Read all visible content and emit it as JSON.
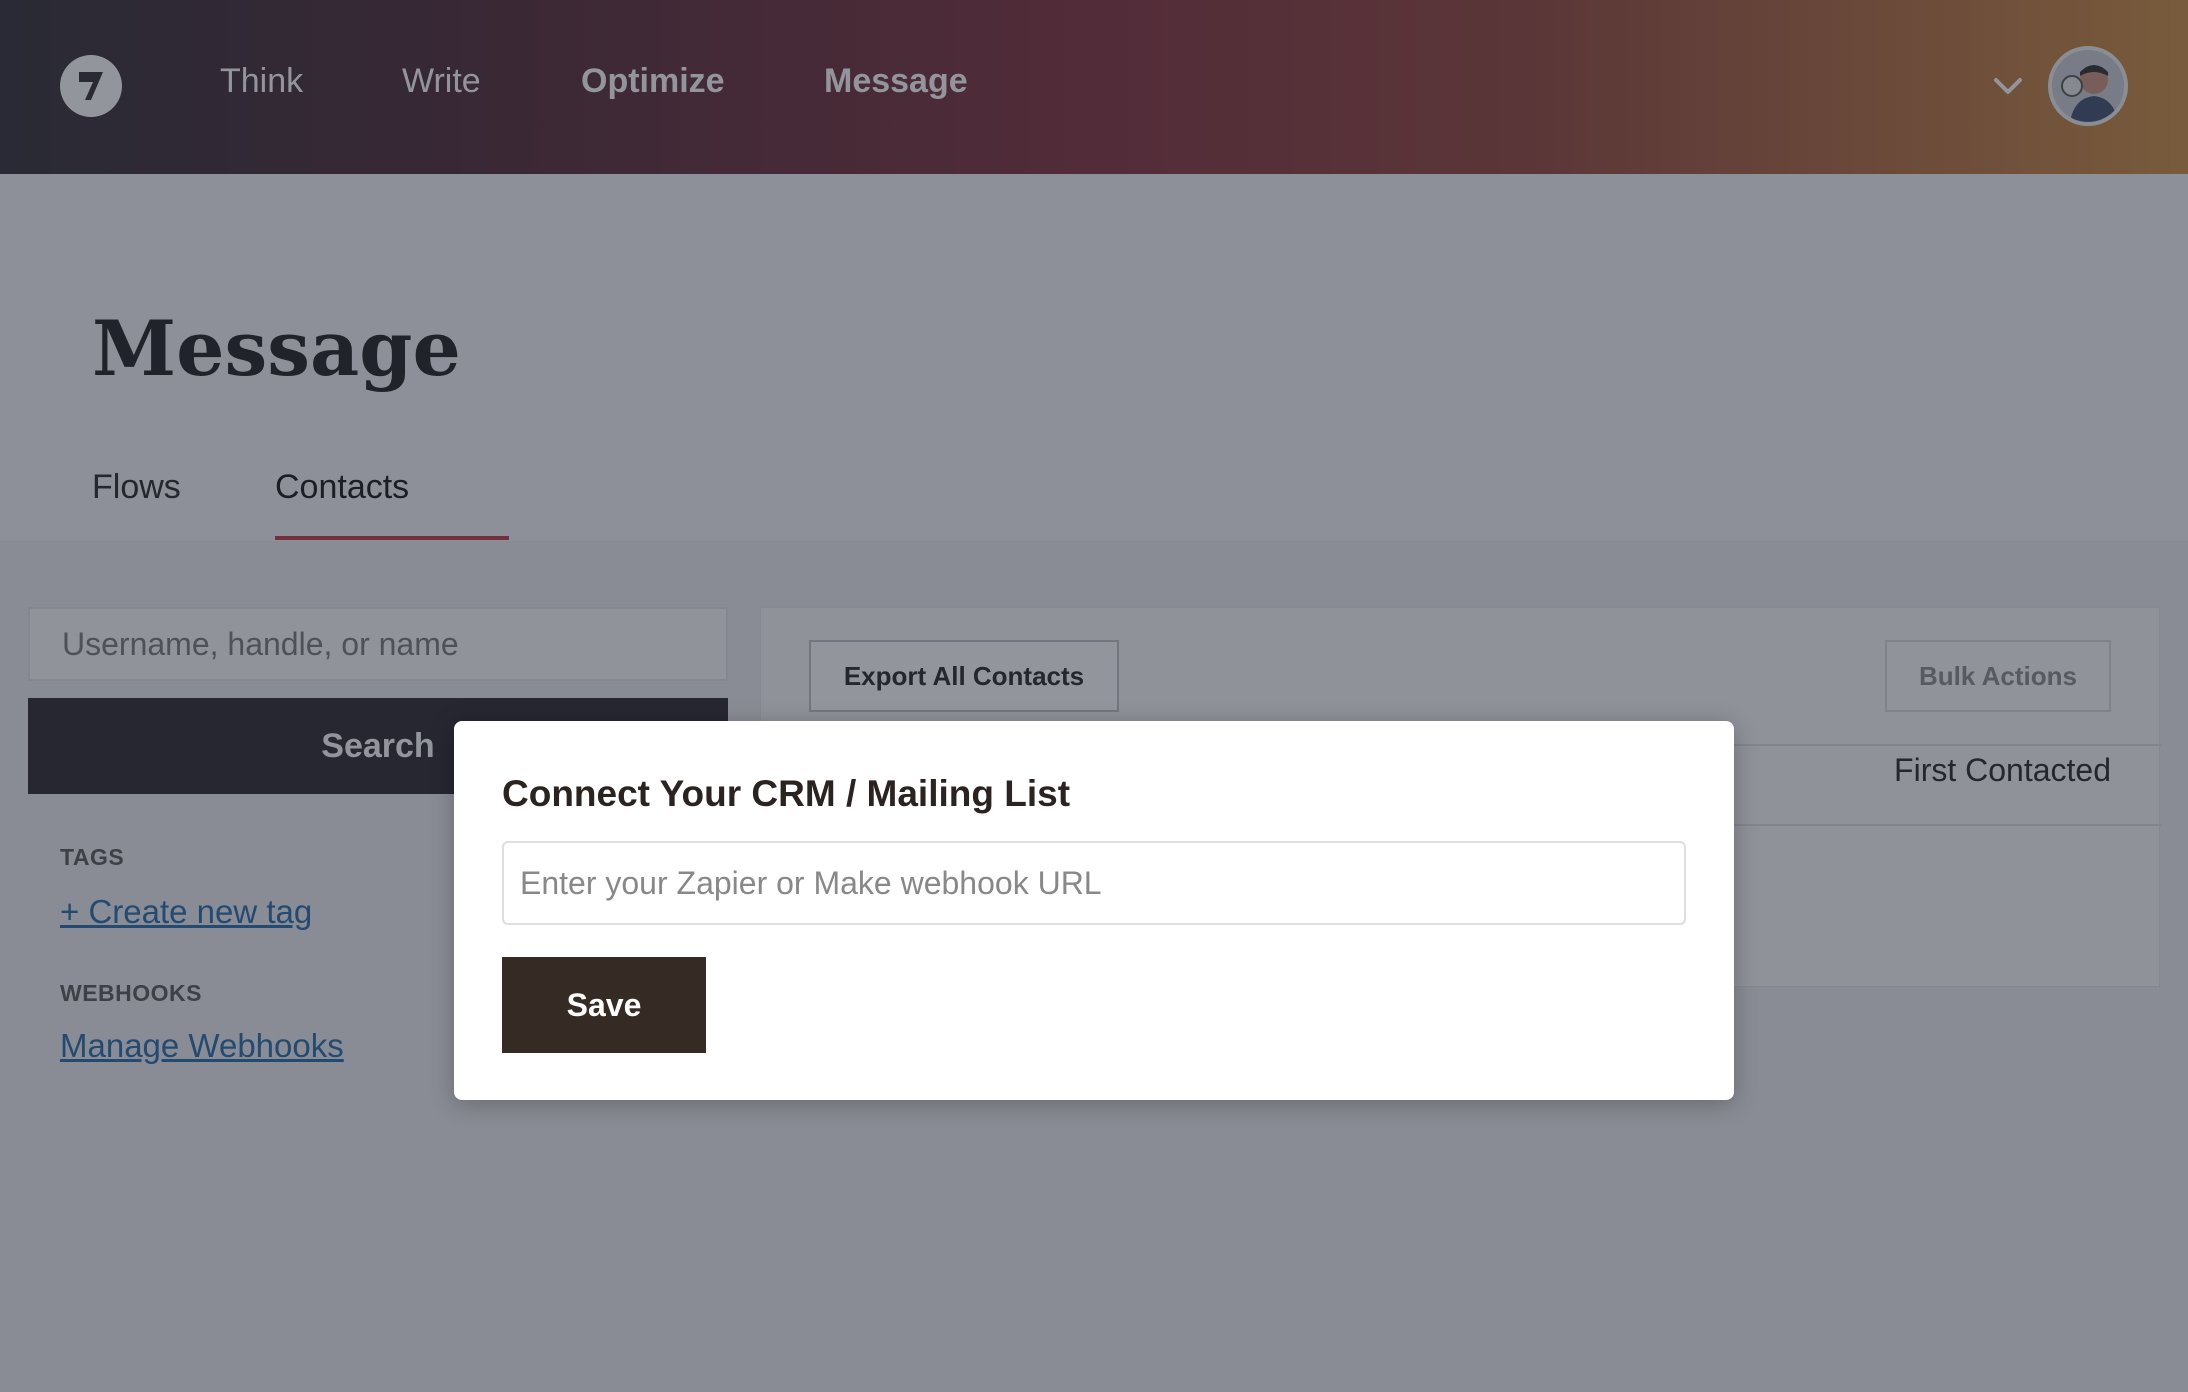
{
  "nav": {
    "logo_icon": "bolt-logo-icon",
    "links": [
      "Think",
      "Write",
      "Optimize",
      "Message"
    ],
    "menu_icon": "chevron-down-icon",
    "avatar_icon": "user-avatar-icon"
  },
  "page": {
    "title": "Message",
    "tabs": [
      {
        "label": "Flows",
        "active": false
      },
      {
        "label": "Contacts",
        "active": true
      }
    ]
  },
  "sidebar": {
    "search": {
      "placeholder": "Username, handle, or name",
      "value": "",
      "button_label": "Search"
    },
    "tags": {
      "heading": "TAGS",
      "link": "+ Create new tag"
    },
    "webhooks": {
      "heading": "WEBHOOKS",
      "link": "Manage Webhooks"
    }
  },
  "contacts_panel": {
    "export_label": "Export All Contacts",
    "bulk_label": "Bulk Actions",
    "columns": [
      "First Contacted"
    ]
  },
  "modal": {
    "title": "Connect Your CRM / Mailing List",
    "input_placeholder": "Enter your Zapier or Make webhook URL",
    "input_value": "",
    "save_label": "Save"
  },
  "colors": {
    "accent": "#c0333f",
    "dark_button": "#26232a",
    "save_button": "#352a24",
    "link": "#1f6aa8"
  }
}
